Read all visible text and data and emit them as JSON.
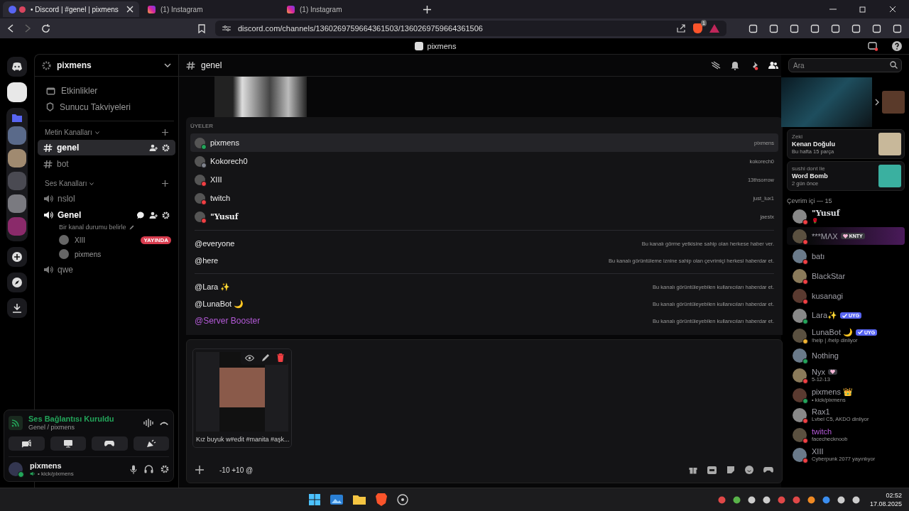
{
  "browser": {
    "tabs": [
      {
        "title": "• Discord | #genel | pixmens",
        "kind": "discord",
        "selected": true
      },
      {
        "title": "(1) Instagram",
        "kind": "instagram",
        "selected": false
      },
      {
        "title": "(1) Instagram",
        "kind": "instagram",
        "selected": false
      }
    ],
    "url": "discord.com/channels/1360269759664361503/1360269759664361506",
    "shield_count": "1"
  },
  "app_title": "pixmens",
  "sidebar": {
    "server_name": "pixmens",
    "links": [
      "Etkinlikler",
      "Sunucu Takviyeleri"
    ],
    "categories": [
      {
        "name": "Metin Kanalları",
        "channels": [
          {
            "name": "genel",
            "kind": "text",
            "selected": true,
            "connected": false
          },
          {
            "name": "bot",
            "kind": "text",
            "selected": false,
            "connected": false
          }
        ]
      },
      {
        "name": "Ses Kanalları",
        "channels": [
          {
            "name": "nslol",
            "kind": "voice",
            "selected": false,
            "connected": false
          },
          {
            "name": "Genel",
            "kind": "voice",
            "selected": false,
            "connected": true,
            "status": "Bir kanal durumu belirle",
            "users": [
              {
                "name": "XIII",
                "badge": "YAYINDA"
              },
              {
                "name": "pixmens"
              }
            ]
          },
          {
            "name": "qwe",
            "kind": "voice",
            "selected": false,
            "connected": false
          }
        ]
      }
    ]
  },
  "voice_panel": {
    "status": "Ses Bağlantısı Kuruldu",
    "location": "Genel / pixmens"
  },
  "user_panel": {
    "name": "pixmens",
    "status": "• kick/pixmens"
  },
  "channel_header": {
    "name": "genel",
    "search_placeholder": "Ara"
  },
  "autocomplete": {
    "heading": "ÜYELER",
    "members": [
      {
        "name": "pixmens",
        "handle": "pixmens",
        "color": "#23a55a",
        "selected": true
      },
      {
        "name": "Kokorech0",
        "handle": "kokorech0",
        "color": "#80848e",
        "selected": false
      },
      {
        "name": "XIII",
        "handle": "13thsorrow",
        "color": "#f23f43",
        "selected": false
      },
      {
        "name": "twitch",
        "handle": "just_lux1",
        "color": "#f23f43",
        "selected": false
      },
      {
        "name": "\"Yusuf",
        "handle": "jaestx",
        "color": "#f23f43",
        "selected": false
      }
    ],
    "mentions": [
      {
        "name": "@everyone",
        "description": "Bu kanalı görme yetkisine sahip olan herkese haber ver."
      },
      {
        "name": "@here",
        "description": "Bu kanalı görüntüleme iznine sahip olan çevrimiçi herkesi haberdar et."
      }
    ],
    "roles": [
      {
        "name": "@Lara ✨",
        "description": "Bu kanalı görüntüleyebilen kullanıcıları haberdar et."
      },
      {
        "name": "@LunaBot 🌙",
        "description": "Bu kanalı görüntüleyebilen kullanıcıları haberdar et."
      },
      {
        "name": "@Server Booster",
        "description": "Bu kanalı görüntüleyebilen kullanıcıları haberdar et.",
        "color": "#b45ad8"
      }
    ]
  },
  "attachment": {
    "caption": "Kız buyuk w#edit #manita #aşk..."
  },
  "composer": {
    "value": "-10 +10 @"
  },
  "activity": [
    {
      "user": "Zeki",
      "title": "Kenan Doğulu",
      "detail": "Bu hafta 15 parça"
    },
    {
      "user": "sushi dont lie",
      "title": "Word Bomb",
      "detail": "2 gün önce"
    }
  ],
  "members": {
    "heading": "Çevrim içi — 15",
    "list": [
      {
        "name": "\"Yusuf",
        "subtitle": "🌹",
        "color": "#f23f43"
      },
      {
        "name": "***MΛX",
        "badge": {
          "kind": "heart",
          "text": "KNTY"
        },
        "color": "#f23f43"
      },
      {
        "name": "batı",
        "color": "#f23f43"
      },
      {
        "name": "BlackStar",
        "color": "#f23f43"
      },
      {
        "name": "kusanagi",
        "color": "#f23f43"
      },
      {
        "name": "Lara✨",
        "badge": {
          "kind": "check",
          "text": "UYG"
        },
        "color": "#23a55a"
      },
      {
        "name": "LunaBot 🌙",
        "badge": {
          "kind": "check",
          "text": "UYG"
        },
        "subtitle": "!help | /help dinliyor",
        "color": "#f0b232"
      },
      {
        "name": "Nothing",
        "color": "#23a55a"
      },
      {
        "name": "Nyx",
        "badge": {
          "kind": "heart"
        },
        "subtitle": "5-12-13",
        "color": "#f23f43"
      },
      {
        "name": "pixmens 👑",
        "subtitle": "• kick/pixmens",
        "color": "#23a55a"
      },
      {
        "name": "Rax1",
        "subtitle": "Lvbel C5, AKDO dinliyor",
        "color": "#f23f43"
      },
      {
        "name": "twitch",
        "role": {
          "color": "#b45ad8"
        },
        "subtitle": "facechecknoob",
        "color": "#f23f43"
      },
      {
        "name": "XIII",
        "subtitle": "Cyberpunk 2077 yayınlıyor",
        "color": "#f23f43"
      }
    ]
  },
  "taskbar": {
    "time": "02:52",
    "date": "17.08.2025"
  }
}
